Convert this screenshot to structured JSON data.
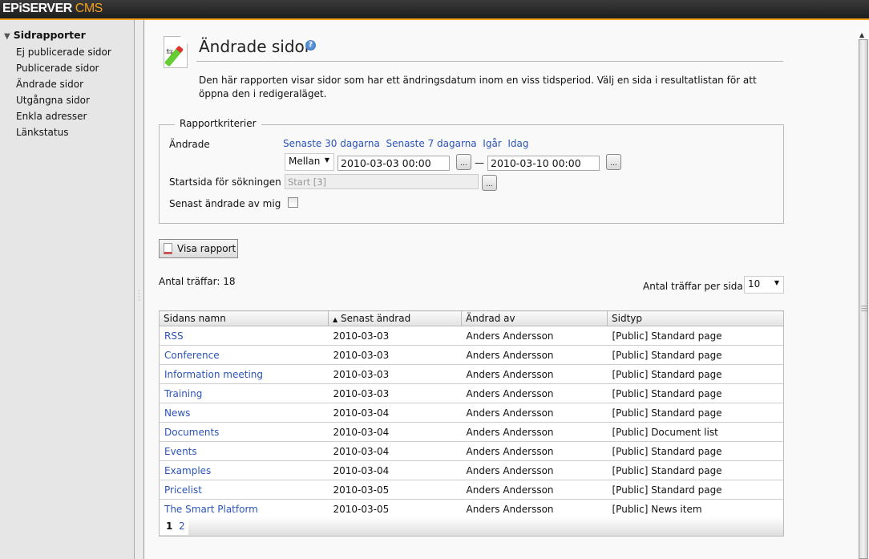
{
  "app": {
    "logo_main": "EPiSERVER",
    "logo_sub": "CMS"
  },
  "sidebar": {
    "heading": "Sidrapporter",
    "items": [
      "Ej publicerade sidor",
      "Publicerade sidor",
      "Ändrade sidor",
      "Utgångna sidor",
      "Enkla adresser",
      "Länkstatus"
    ]
  },
  "page": {
    "title": "Ändrade sidor",
    "help_icon": "?",
    "description": "Den här rapporten visar sidor som har ett ändringsdatum inom en viss tidsperiod. Välj en sida i resultatlistan för att öppna den i redigeraläget."
  },
  "criteria": {
    "legend": "Rapportkriterier",
    "changed_label": "Ändrade",
    "quick_links": [
      "Senaste 30 dagarna",
      "Senaste 7 dagarna",
      "Igår",
      "Idag"
    ],
    "range_mode": "Mellan",
    "from": "2010-03-03 00:00",
    "to": "2010-03-10 00:00",
    "dash": "—",
    "browse": "...",
    "start_label": "Startsida för sökningen",
    "start_value": "Start [3]",
    "mine_label": "Senast ändrade av mig",
    "mine_checked": false
  },
  "show_button": "Visa rapport",
  "results": {
    "count_label": "Antal träffar: 18",
    "per_page_label": "Antal träffar per sida",
    "per_page": "10",
    "columns": [
      "Sidans namn",
      "Senast ändrad",
      "Ändrad av",
      "Sidtyp"
    ],
    "sort_icon": "▲",
    "rows": [
      [
        "RSS",
        "2010-03-03",
        "Anders Andersson",
        "[Public] Standard page"
      ],
      [
        "Conference",
        "2010-03-03",
        "Anders Andersson",
        "[Public] Standard page"
      ],
      [
        "Information meeting",
        "2010-03-03",
        "Anders Andersson",
        "[Public] Standard page"
      ],
      [
        "Training",
        "2010-03-03",
        "Anders Andersson",
        "[Public] Standard page"
      ],
      [
        "News",
        "2010-03-04",
        "Anders Andersson",
        "[Public] Standard page"
      ],
      [
        "Documents",
        "2010-03-04",
        "Anders Andersson",
        "[Public] Document list"
      ],
      [
        "Events",
        "2010-03-04",
        "Anders Andersson",
        "[Public] Standard page"
      ],
      [
        "Examples",
        "2010-03-04",
        "Anders Andersson",
        "[Public] Standard page"
      ],
      [
        "Pricelist",
        "2010-03-05",
        "Anders Andersson",
        "[Public] Standard page"
      ],
      [
        "The Smart Platform",
        "2010-03-05",
        "Anders Andersson",
        "[Public] News item"
      ]
    ],
    "pages": [
      "1",
      "2"
    ],
    "current_page": "1"
  }
}
